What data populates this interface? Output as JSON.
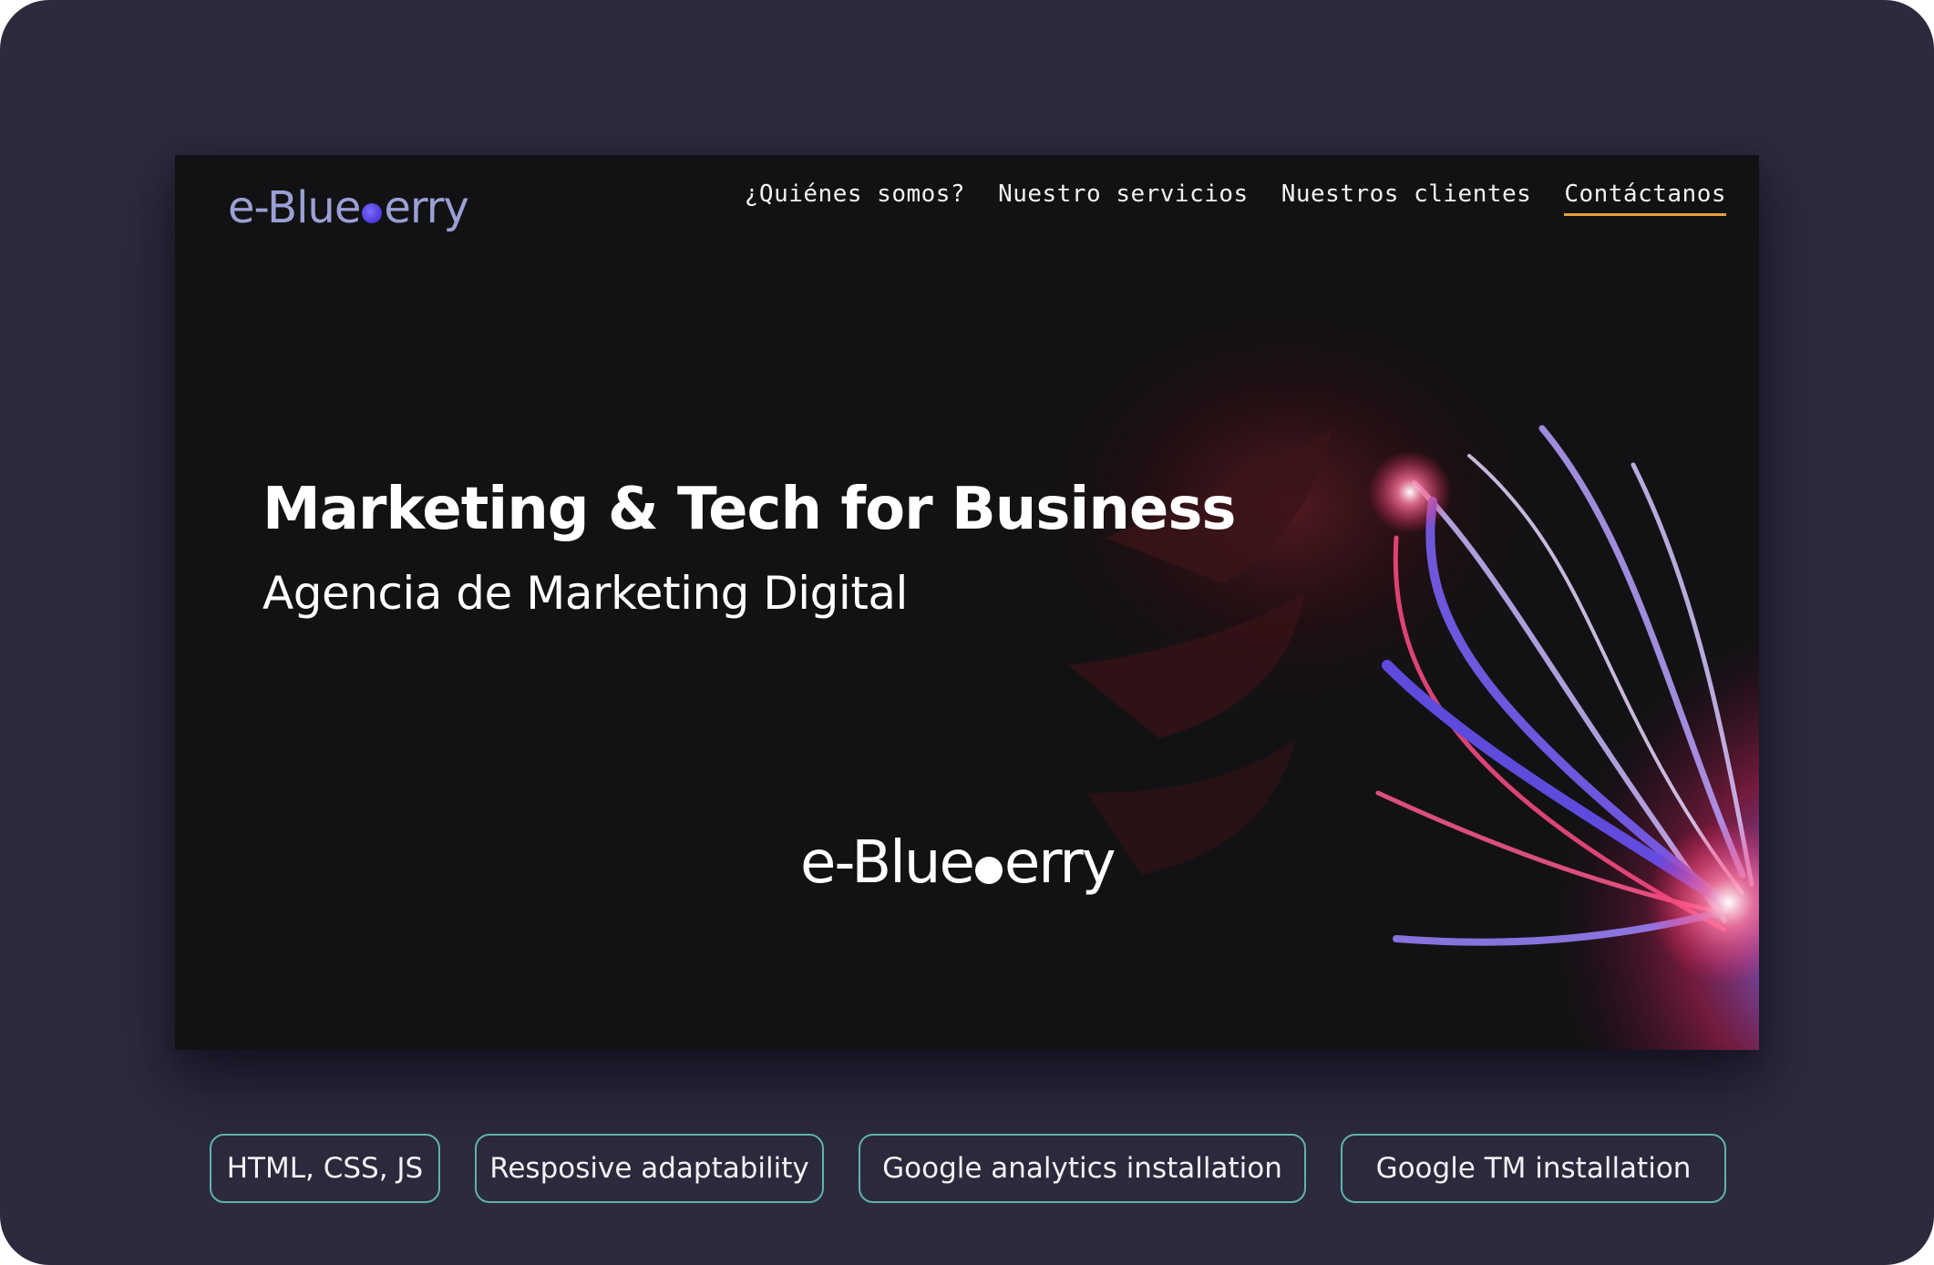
{
  "site": {
    "logo_text_1": "e-Blue",
    "logo_text_2": "erry",
    "nav": [
      {
        "label": "¿Quiénes somos?",
        "active": false
      },
      {
        "label": "Nuestro servicios",
        "active": false
      },
      {
        "label": "Nuestros clientes",
        "active": false
      },
      {
        "label": "Contáctanos",
        "active": true
      }
    ],
    "hero": {
      "title": "Marketing & Tech for Business",
      "subtitle": "Agencia de Marketing Digital"
    },
    "center_logo_1": "e-Blue",
    "center_logo_2": "erry"
  },
  "tags": [
    "HTML, CSS, JS",
    "Resposive adaptability",
    "Google analytics installation",
    "Google TM installation"
  ],
  "colors": {
    "card_bg": "#2d2a3d",
    "site_bg": "#121214",
    "accent_underline": "#e8a33a",
    "tag_border": "#5fb3ad",
    "logo": "#9aa0d4"
  }
}
